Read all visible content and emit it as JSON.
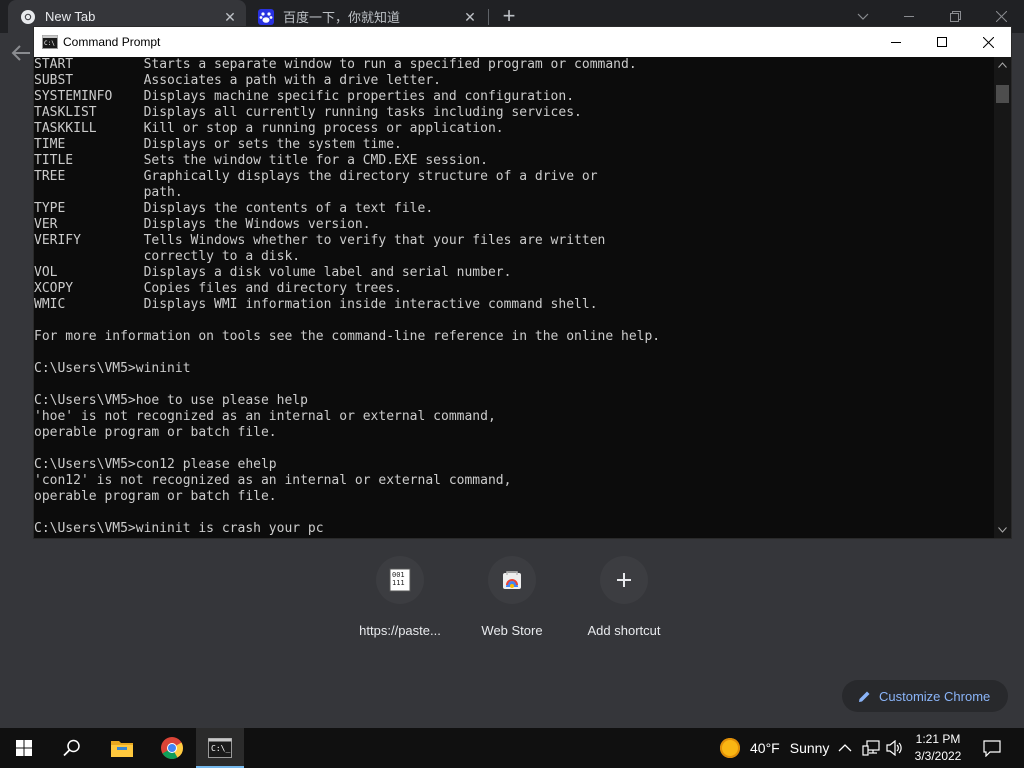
{
  "chrome": {
    "tabs": [
      {
        "title": "New Tab",
        "icon": "chrome-icon"
      },
      {
        "title": "百度一下，你就知道",
        "icon": "baidu-icon"
      }
    ],
    "shortcuts": [
      {
        "label": "https://paste...",
        "icon": "binary-file-icon"
      },
      {
        "label": "Web Store",
        "icon": "web-store-icon"
      },
      {
        "label": "Add shortcut",
        "icon": "plus-icon"
      }
    ],
    "customize_label": "Customize Chrome"
  },
  "cmd": {
    "title": "Command Prompt",
    "lines": [
      "START         Starts a separate window to run a specified program or command.",
      "SUBST         Associates a path with a drive letter.",
      "SYSTEMINFO    Displays machine specific properties and configuration.",
      "TASKLIST      Displays all currently running tasks including services.",
      "TASKKILL      Kill or stop a running process or application.",
      "TIME          Displays or sets the system time.",
      "TITLE         Sets the window title for a CMD.EXE session.",
      "TREE          Graphically displays the directory structure of a drive or",
      "              path.",
      "TYPE          Displays the contents of a text file.",
      "VER           Displays the Windows version.",
      "VERIFY        Tells Windows whether to verify that your files are written",
      "              correctly to a disk.",
      "VOL           Displays a disk volume label and serial number.",
      "XCOPY         Copies files and directory trees.",
      "WMIC          Displays WMI information inside interactive command shell.",
      "",
      "For more information on tools see the command-line reference in the online help.",
      "",
      "C:\\Users\\VM5>wininit",
      "",
      "C:\\Users\\VM5>hoe to use please help",
      "'hoe' is not recognized as an internal or external command,",
      "operable program or batch file.",
      "",
      "C:\\Users\\VM5>con12 please ehelp",
      "'con12' is not recognized as an internal or external command,",
      "operable program or batch file.",
      "",
      "C:\\Users\\VM5>wininit is crash your pc"
    ]
  },
  "taskbar": {
    "weather_temp": "40°F",
    "weather_desc": "Sunny",
    "time": "1:21 PM",
    "date": "3/3/2022"
  }
}
